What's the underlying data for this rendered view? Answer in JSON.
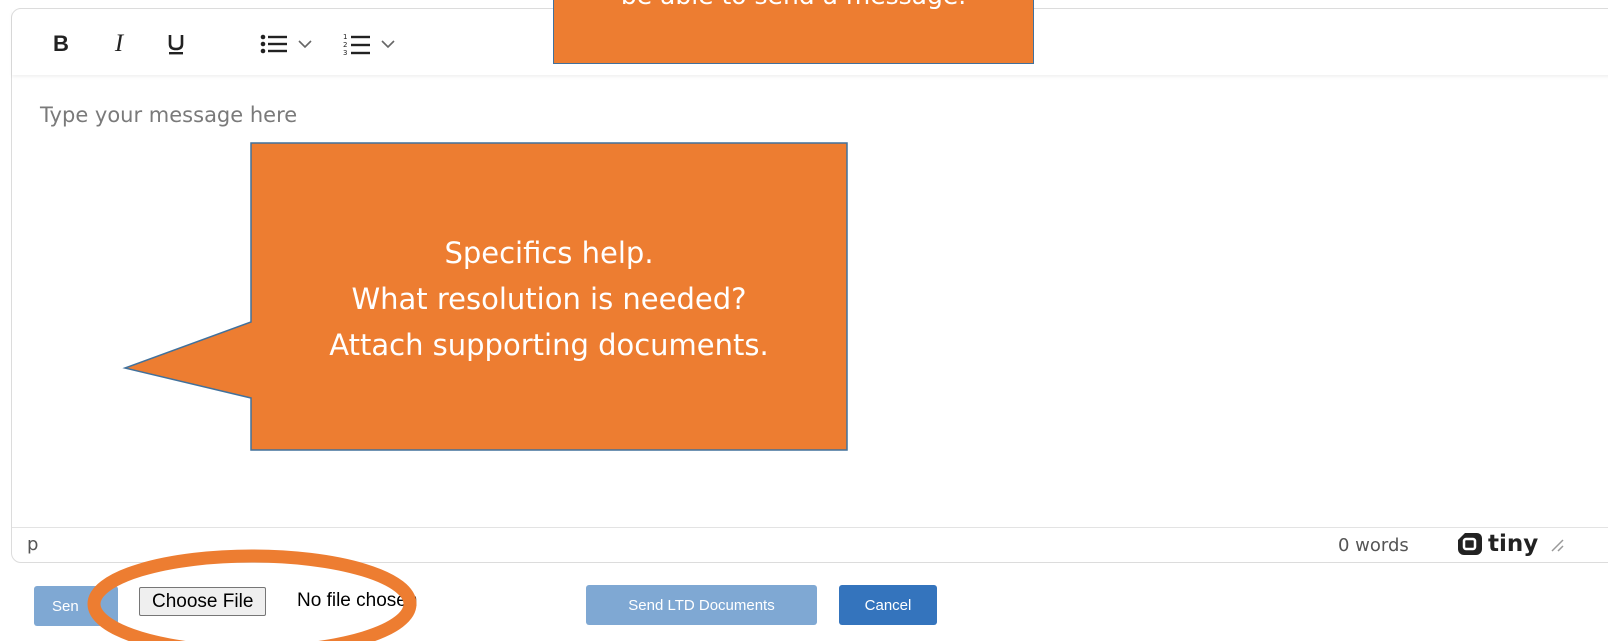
{
  "editor": {
    "toolbar": {
      "bold_label": "B",
      "italic_label": "I",
      "underline_icon": "underline-icon",
      "bullet_list_icon": "bullet-list-icon",
      "numbered_list_icon": "numbered-list-icon"
    },
    "placeholder": "Type your message here",
    "statusbar": {
      "path": "p",
      "word_count": "0 words",
      "brand": "tiny"
    }
  },
  "actions": {
    "send_label": "Send",
    "send_visible": "Sen",
    "choose_file_label": "Choose File",
    "file_status": "No file chosen",
    "send_ltd_label": "Send LTD Documents",
    "cancel_label": "Cancel"
  },
  "annotations": {
    "top_callout": "be able to send a message.",
    "main_callout": [
      "Specifics help.",
      "What resolution is needed?",
      "Attach supporting documents."
    ]
  },
  "colors": {
    "callout_fill": "#ed7d31",
    "callout_border": "#41719c",
    "primary_button": "#3474bd",
    "disabled_button": "#7fa8d3"
  }
}
